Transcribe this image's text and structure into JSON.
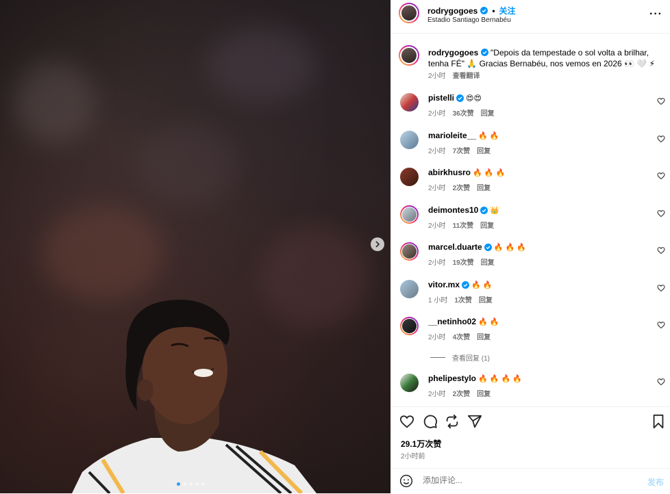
{
  "post": {
    "username": "rodrygogoes",
    "follow_label": "关注",
    "separator": "•",
    "location": "Estadio Santiago Bernabéu",
    "more_label": "···"
  },
  "caption": {
    "username": "rodrygogoes",
    "text": "\"Depois da tempestade o sol volta a brilhar, tenha FÉ\" 🙏 Gracias Bernabéu, nos vemos en 2026 👀 🤍 ⚡",
    "time": "2小时",
    "translate_label": "查看翻译"
  },
  "comments": [
    {
      "username": "pistelli",
      "verified": true,
      "text": "😍😍",
      "time": "2小时",
      "likes": "36次赞",
      "reply": "回复"
    },
    {
      "username": "marioleite__",
      "verified": false,
      "text": "🔥 🔥",
      "time": "2小时",
      "likes": "7次赞",
      "reply": "回复"
    },
    {
      "username": "abirkhusro",
      "verified": false,
      "text": "🔥 🔥 🔥",
      "time": "2小时",
      "likes": "2次赞",
      "reply": "回复"
    },
    {
      "username": "deimontes10",
      "verified": true,
      "text": "👑",
      "time": "2小时",
      "likes": "11次赞",
      "reply": "回复"
    },
    {
      "username": "marcel.duarte",
      "verified": true,
      "text": "🔥 🔥 🔥",
      "time": "2小时",
      "likes": "19次赞",
      "reply": "回复"
    },
    {
      "username": "vitor.mx",
      "verified": true,
      "text": "🔥 🔥",
      "time": "1 小时",
      "likes": "1次赞",
      "reply": "回复"
    },
    {
      "username": "__netinho02",
      "verified": false,
      "text": "🔥 🔥",
      "time": "2小时",
      "likes": "4次赞",
      "reply": "回复"
    },
    {
      "username": "phelipestylo",
      "verified": false,
      "text": "🔥 🔥 🔥 🔥",
      "time": "2小时",
      "likes": "2次赞",
      "reply": "回复"
    }
  ],
  "view_replies_label": "查看回复 (1)",
  "footer": {
    "likes": "29.1万次赞",
    "time": "2小时前",
    "comment_placeholder": "添加评论...",
    "post_label": "发布"
  },
  "colors": {
    "accent": "#0095f6",
    "verified": "#0095f6",
    "muted": "#737373",
    "carousel_active_dot": "#3897f0"
  },
  "icons": [
    "verified-badge-icon",
    "more-options-icon",
    "heart-icon",
    "comment-icon",
    "share-icon",
    "send-icon",
    "bookmark-icon",
    "emoji-icon",
    "next-arrow-icon"
  ]
}
